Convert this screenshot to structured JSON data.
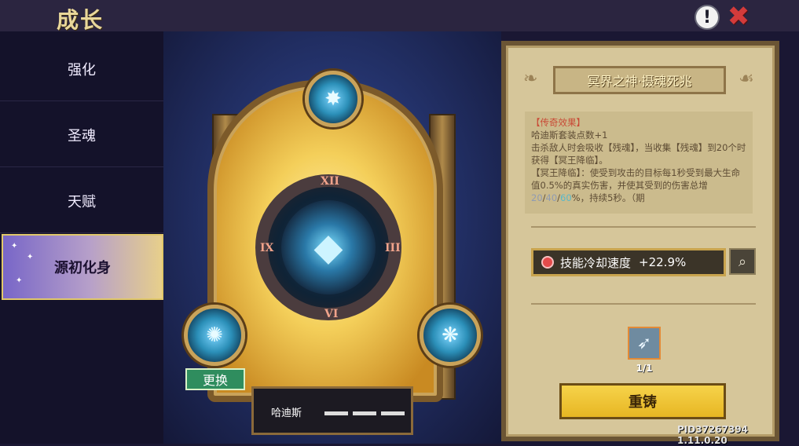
{
  "header": {
    "title": "成长",
    "info_icon": "!",
    "close_icon": "✖"
  },
  "sidebar": {
    "items": [
      {
        "label": "强化"
      },
      {
        "label": "圣魂"
      },
      {
        "label": "天赋"
      },
      {
        "label": "源初化身",
        "active": true
      }
    ]
  },
  "scene": {
    "numerals": {
      "top": "XII",
      "left": "IX",
      "right": "III",
      "bottom": "VI"
    },
    "swap_button": "更换",
    "name_plate": "哈迪斯"
  },
  "panel": {
    "title": "冥界之神·摄魂死兆",
    "desc": {
      "heading": "【传奇效果】",
      "line1": "哈迪斯套装点数+1",
      "line2": "击杀敌人时会吸收【残魂】，当收集【残魂】到20个时获得【冥王降临】。",
      "line3a": "【冥王降临】：使受到攻击的目标每1秒受到最大生命值0.5%的真实伤害，并使其受到的伤害总增",
      "v1": "20",
      "sep1": "/",
      "v2": "40",
      "sep2": "/",
      "v3": "60",
      "line3b": "%，持续5秒。（期"
    },
    "stat": {
      "label": "技能冷却速度",
      "value": "+22.9%"
    },
    "item_count": "1/1",
    "recast_button": "重铸"
  },
  "version": "PID37267394 1.11.0.20",
  "colors": {
    "active_tab_from": "#7866c8",
    "active_tab_to": "#e7cf8b",
    "recast_button": "#f6d34a",
    "swap_button": "#2f8d5e"
  }
}
